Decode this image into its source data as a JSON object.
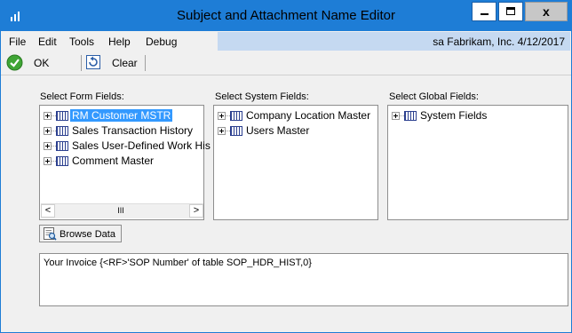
{
  "window": {
    "title": "Subject and Attachment Name Editor",
    "accent": "#1e7dd6",
    "controls": {
      "minimize": "–",
      "maximize": "□",
      "close": "x"
    }
  },
  "menu": {
    "items": [
      "File",
      "Edit",
      "Tools",
      "Help",
      "Debug"
    ],
    "status": "sa  Fabrikam, Inc.  4/12/2017"
  },
  "toolbar": {
    "ok_label": "OK",
    "clear_label": "Clear"
  },
  "form_fields": {
    "label": "Select Form Fields:",
    "items": [
      "RM Customer MSTR",
      "Sales Transaction History",
      "Sales User-Defined Work His",
      "Comment Master"
    ],
    "selected_index": 0
  },
  "system_fields": {
    "label": "Select System Fields:",
    "items": [
      "Company Location Master",
      "Users Master"
    ]
  },
  "global_fields": {
    "label": "Select Global Fields:",
    "items": [
      "System Fields"
    ]
  },
  "browse_label": "Browse Data",
  "expression": "Your Invoice {<RF>'SOP Number' of table SOP_HDR_HIST,0}"
}
